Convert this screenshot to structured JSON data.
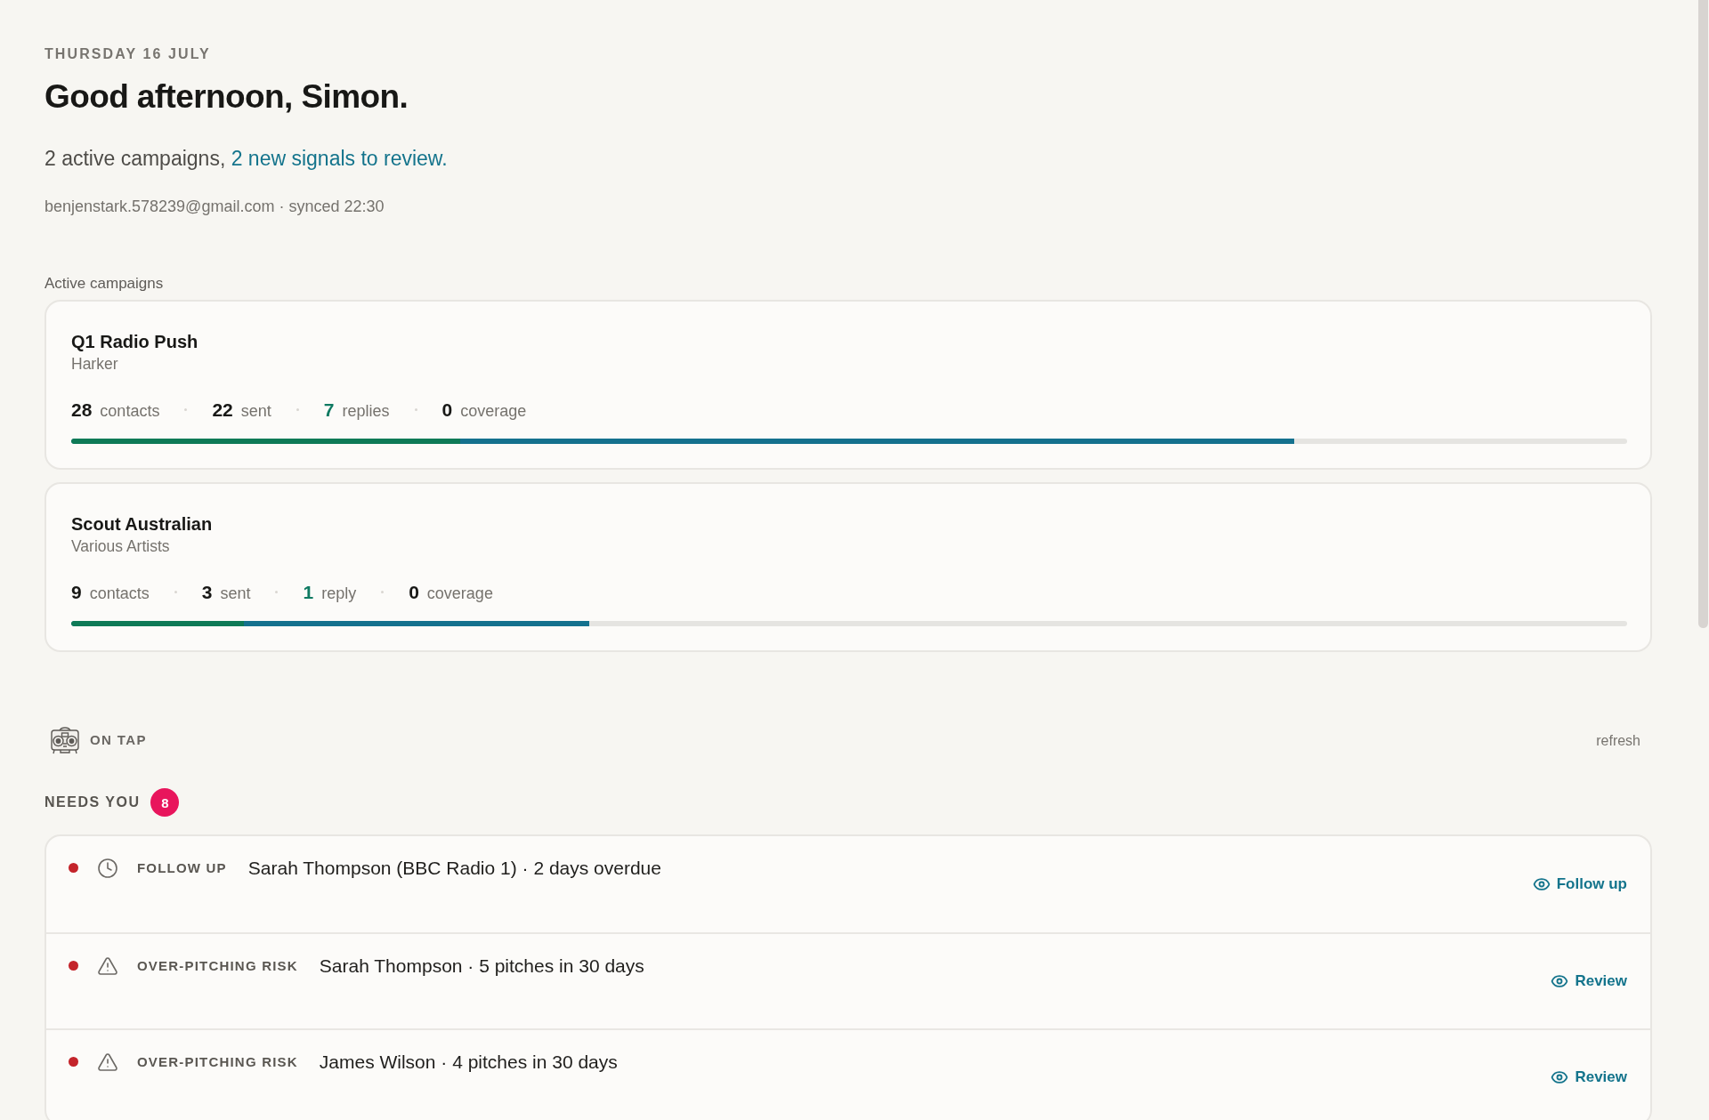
{
  "header": {
    "date": "THURSDAY 16 JULY",
    "greeting": "Good afternoon, Simon.",
    "summary": {
      "text": "2 active campaigns,",
      "link": "2 new signals to review."
    },
    "account": "benjenstark.578239@gmail.com · synced 22:30"
  },
  "campaigns_section": {
    "title": "Active campaigns",
    "campaigns": [
      {
        "name": "Q1 Radio Push",
        "artist": "Harker",
        "stats": [
          {
            "kind": "plain",
            "value": "28",
            "label": "contacts"
          },
          {
            "kind": "plain",
            "value": "22",
            "label": "sent"
          },
          {
            "kind": "reply",
            "value": "7",
            "label": "replies"
          },
          {
            "kind": "plain",
            "value": "0",
            "label": "coverage"
          }
        ],
        "progress": [
          {
            "kind": "replied",
            "level": 0.25
          },
          {
            "kind": "sent",
            "level": 0.786
          }
        ]
      },
      {
        "name": "Scout Australian",
        "artist": "Various Artists",
        "stats": [
          {
            "kind": "plain",
            "value": "9",
            "label": "contacts"
          },
          {
            "kind": "plain",
            "value": "3",
            "label": "sent"
          },
          {
            "kind": "reply",
            "value": "1",
            "label": "reply"
          },
          {
            "kind": "plain",
            "value": "0",
            "label": "coverage"
          }
        ],
        "progress": [
          {
            "kind": "replied",
            "level": 0.111
          },
          {
            "kind": "sent",
            "level": 0.333
          }
        ]
      }
    ]
  },
  "on_tap": {
    "title": "ON TAP",
    "refresh": "refresh"
  },
  "needs_you": {
    "title": "NEEDS YOU",
    "count": "8",
    "items": [
      {
        "kind": "follow_up",
        "color": "#c4242b",
        "label": "FOLLOW UP",
        "text": "Sarah Thompson (BBC Radio 1) · 2 days overdue",
        "action": "Follow up"
      },
      {
        "kind": "over_pitching",
        "color": "#c4242b",
        "label": "OVER-PITCHING RISK",
        "text": "Sarah Thompson · 5 pitches in 30 days",
        "action": "Review"
      },
      {
        "kind": "over_pitching",
        "color": "#c4242b",
        "label": "OVER-PITCHING RISK",
        "text": "James Wilson · 4 pitches in 30 days",
        "action": "Review"
      }
    ]
  }
}
